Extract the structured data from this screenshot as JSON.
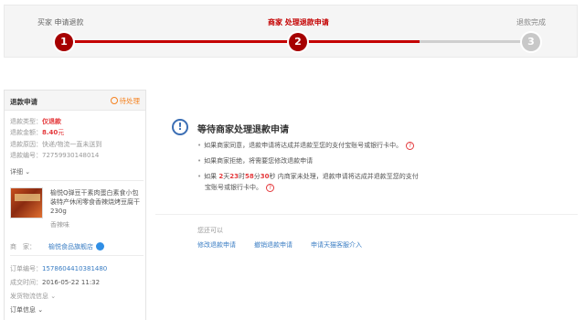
{
  "progress": {
    "steps": [
      {
        "label": "买家 申请退款",
        "number": "1"
      },
      {
        "label": "商家 处理退款申请",
        "number": "2"
      },
      {
        "label": "退款完成",
        "number": "3"
      }
    ],
    "current_step": 2
  },
  "refund_panel": {
    "title": "退款申请",
    "status": "待处理",
    "type_label": "退款类型：",
    "type_value": "仅退款",
    "amount_label": "退款金额：",
    "amount_value": "8.40",
    "amount_unit": "元",
    "reason_label": "退款原因：",
    "reason_value": "快递/物流一直未送到",
    "number_label": "退款编号：",
    "number_value": "72759930148014",
    "detail_toggle": "详细 ⌄"
  },
  "product": {
    "title": "榆悦Q弹豆干素肉蛋白素食小包装特产休闲零食香辣烧烤豆腐干230g",
    "flavor": "香辣味"
  },
  "seller": {
    "label": "商　家：",
    "name": "榆悦食品旗舰店"
  },
  "order": {
    "number_label": "订单编号：",
    "number_value": "1578604410381480",
    "time_label": "成交时间：",
    "time_value": "2016-05-22 11:32",
    "shipping_label": "发货物流信息 ⌄",
    "order_info_label": "订单信息 ⌄"
  },
  "main": {
    "title": "等待商家处理退款申请",
    "bullet1": "如果商家同意，退款申请将达成并退款至您的支付宝账号或银行卡中。",
    "bullet2": "如果商家拒绝，将需要您修改退款申请",
    "bullet3_prefix": "如果",
    "countdown": {
      "days": "2",
      "days_unit": "天",
      "hours": "23",
      "hours_unit": "时",
      "minutes": "58",
      "minutes_unit": "分",
      "seconds": "30",
      "seconds_unit": "秒"
    },
    "bullet3_suffix": "内商家未处理，退款申请将达成并退款至您的支付",
    "bullet3_line2": "宝账号或银行卡中。",
    "can_label": "您还可以",
    "actions": [
      "修改退款申请",
      "撤销退款申请",
      "申请天猫客服介入"
    ]
  },
  "colors": {
    "accent": "#c40000",
    "link": "#3b7ec4",
    "warning": "#f58220"
  }
}
